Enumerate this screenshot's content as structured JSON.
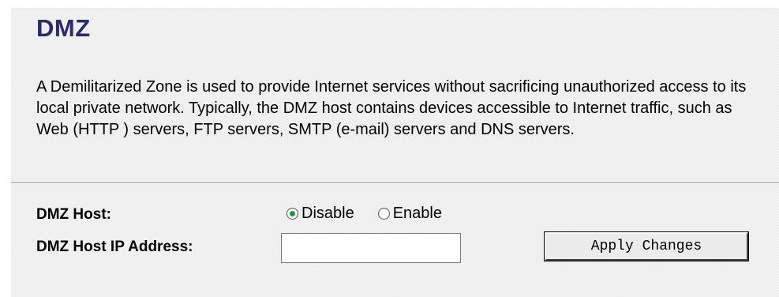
{
  "page": {
    "title": "DMZ",
    "description": "A Demilitarized Zone is used to provide Internet services without sacrificing unauthorized access to its local private network. Typically, the DMZ host contains devices accessible to Internet traffic, such as Web (HTTP ) servers, FTP servers, SMTP (e-mail) servers and DNS servers."
  },
  "form": {
    "dmz_host_label": "DMZ Host:",
    "dmz_host_options": [
      {
        "label": "Disable",
        "checked": true
      },
      {
        "label": "Enable",
        "checked": false
      }
    ],
    "dmz_ip_label": "DMZ Host IP Address:",
    "dmz_ip_value": "",
    "apply_label": "Apply Changes"
  },
  "colors": {
    "title": "#2b2b6e",
    "radio_dot": "#1f9a3a"
  }
}
